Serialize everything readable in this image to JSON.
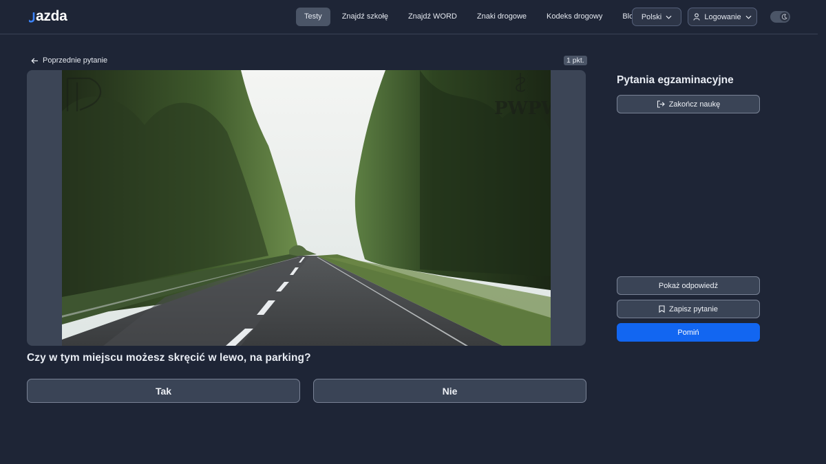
{
  "header": {
    "logo_text": "azda",
    "nav": [
      {
        "label": "Testy",
        "active": true
      },
      {
        "label": "Znajdź szkołę"
      },
      {
        "label": "Znajdź WORD"
      },
      {
        "label": "Znaki drogowe"
      },
      {
        "label": "Kodeks drogowy"
      },
      {
        "label": "Blog"
      }
    ],
    "language": "Polski",
    "login": "Logowanie",
    "theme_toggle_icon": "moon-icon"
  },
  "main": {
    "prev_label": "Poprzednie pytanie",
    "points": "1 pkt.",
    "question": "Czy w tym miejscu możesz skręcić w lewo, na parking?",
    "answers": {
      "yes": "Tak",
      "no": "Nie"
    }
  },
  "sidebar": {
    "title": "Pytania egzaminacyjne",
    "finish": "Zakończ naukę",
    "show_answer": "Pokaż odpowiedź",
    "save_question": "Zapisz pytanie",
    "skip": "Pomiń"
  },
  "colors": {
    "background": "#1e2536",
    "button": "#3a4456",
    "accent": "#1266f1"
  }
}
